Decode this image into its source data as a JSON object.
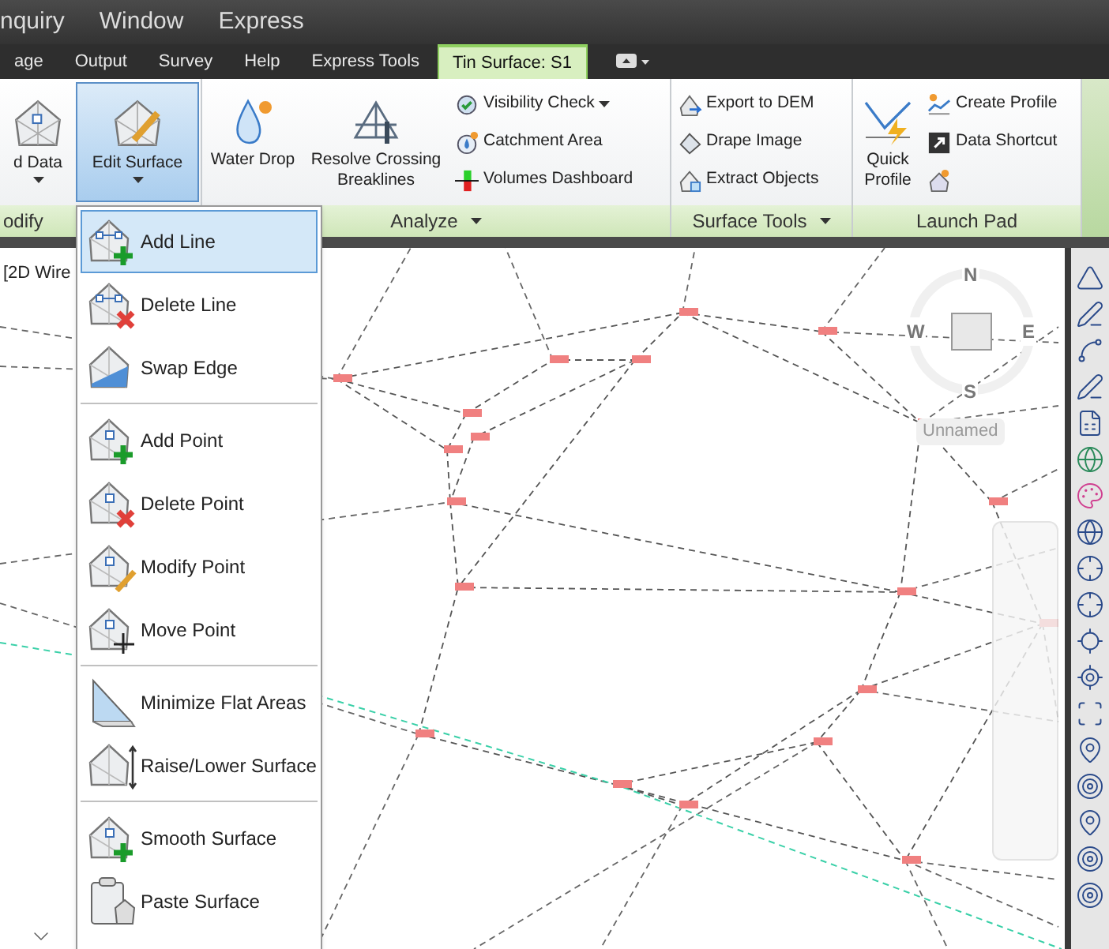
{
  "menu_bar": [
    "nquiry",
    "Window",
    "Express"
  ],
  "ribbon_tabs": [
    {
      "label": "age",
      "selected": false
    },
    {
      "label": "Output",
      "selected": false
    },
    {
      "label": "Survey",
      "selected": false
    },
    {
      "label": "Help",
      "selected": false
    },
    {
      "label": "Express Tools",
      "selected": false
    },
    {
      "label": "Tin Surface: S1",
      "selected": true
    }
  ],
  "ribbon_panels": [
    {
      "label": "odify",
      "buttons": [
        {
          "kind": "large",
          "label": "d Data",
          "dropdown": true,
          "pressed": false
        },
        {
          "kind": "large",
          "label": "Edit Surface",
          "dropdown": true,
          "pressed": true
        }
      ]
    },
    {
      "label": "Analyze",
      "has_menu": true,
      "buttons": [
        {
          "kind": "large",
          "label": "Water Drop",
          "pressed": false
        },
        {
          "kind": "large",
          "label": "Resolve Crossing Breaklines",
          "pressed": false
        },
        {
          "kind": "small",
          "label": "Visibility Check",
          "dropdown": true,
          "pressed": false
        },
        {
          "kind": "small",
          "label": "Catchment Area",
          "pressed": false
        },
        {
          "kind": "small",
          "label": "Volumes Dashboard",
          "pressed": false
        }
      ]
    },
    {
      "label": "Surface Tools",
      "has_menu": true,
      "buttons": [
        {
          "kind": "small",
          "label": "Export to DEM",
          "pressed": false
        },
        {
          "kind": "small",
          "label": "Drape Image",
          "pressed": false
        },
        {
          "kind": "small",
          "label": "Extract Objects",
          "pressed": false
        }
      ]
    },
    {
      "label": "Launch Pad",
      "buttons": [
        {
          "kind": "large",
          "label": "Quick Profile",
          "pressed": false
        },
        {
          "kind": "small",
          "label": "Create Profile",
          "pressed": false
        },
        {
          "kind": "small",
          "label": "Data Shortcut",
          "pressed": false
        },
        {
          "kind": "icon",
          "pressed": false
        }
      ]
    }
  ],
  "viewport": {
    "label": "[2D Wire",
    "view_cube": {
      "north": "N",
      "west": "W",
      "east": "E",
      "south": "S",
      "ucs": "Unnamed"
    }
  },
  "edit_menu": {
    "groups": [
      [
        {
          "label": "Add Line",
          "selected": true
        },
        {
          "label": "Delete Line",
          "selected": false
        },
        {
          "label": "Swap Edge",
          "selected": false
        }
      ],
      [
        {
          "label": "Add Point",
          "selected": false
        },
        {
          "label": "Delete Point",
          "selected": false
        },
        {
          "label": "Modify Point",
          "selected": false
        },
        {
          "label": "Move Point",
          "selected": false
        }
      ],
      [
        {
          "label": "Minimize Flat Areas",
          "selected": false
        },
        {
          "label": "Raise/Lower Surface",
          "selected": false
        }
      ],
      [
        {
          "label": "Smooth Surface",
          "selected": false
        },
        {
          "label": "Paste Surface",
          "selected": false
        }
      ]
    ]
  }
}
